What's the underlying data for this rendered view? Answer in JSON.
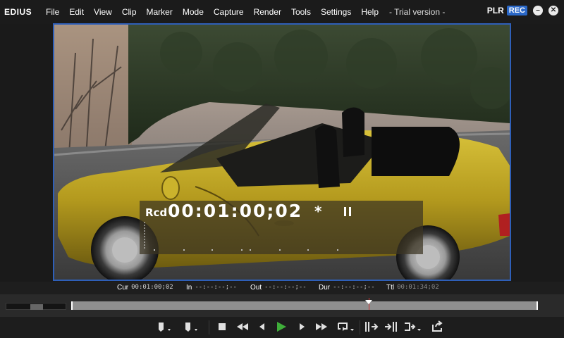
{
  "app": {
    "logo": "EDIUS",
    "menu": [
      "File",
      "Edit",
      "View",
      "Clip",
      "Marker",
      "Mode",
      "Capture",
      "Render",
      "Tools",
      "Settings",
      "Help"
    ],
    "trial_text": "- Trial version -",
    "plr_label": "PLR",
    "rec_label": "REC",
    "minimize_glyph": "–",
    "close_glyph": "✕"
  },
  "overlay": {
    "rcd_label": "Rcd",
    "timecode": "00:01:00;02",
    "star": "*"
  },
  "timecodes": {
    "cur_label": "Cur",
    "cur_value": "00:01:00;02",
    "in_label": "In",
    "in_value": "--:--:--;--",
    "out_label": "Out",
    "out_value": "--:--:--;--",
    "dur_label": "Dur",
    "dur_value": "--:--:--;--",
    "ttl_label": "Ttl",
    "ttl_value": "00:01:34;02"
  },
  "scrubber": {
    "position_fraction": 0.638
  },
  "colors": {
    "accent_blue": "#2e5fb8",
    "rec_blue": "#2a68c8",
    "play_green": "#3fae3a"
  },
  "transport": {
    "buttons": [
      "set-in-point",
      "set-out-point",
      "stop",
      "rewind",
      "previous-frame",
      "play",
      "next-frame",
      "fast-forward",
      "loop-play",
      "insert-to-timeline",
      "overwrite-to-timeline",
      "add-to-bin",
      "export"
    ]
  }
}
